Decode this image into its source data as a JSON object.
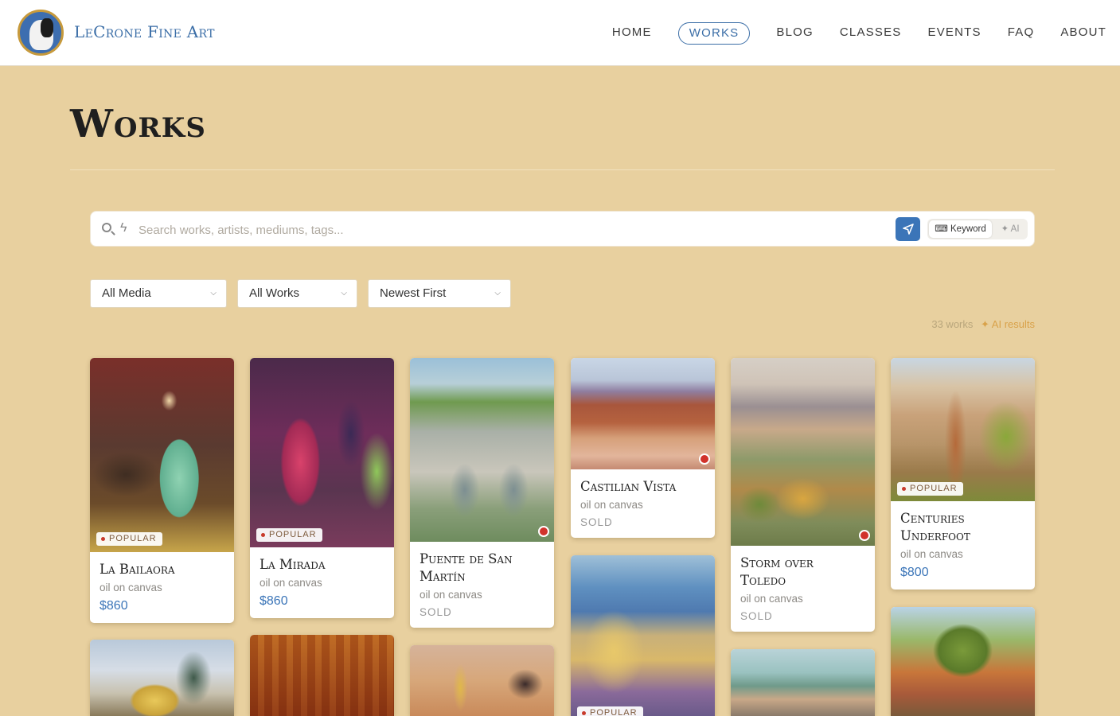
{
  "brand": {
    "name": "LeCrone Fine Art"
  },
  "nav": {
    "home": "HOME",
    "works": "WORKS",
    "blog": "BLOG",
    "classes": "CLASSES",
    "events": "EVENTS",
    "faq": "FAQ",
    "about": "ABOUT"
  },
  "page": {
    "title": "Works"
  },
  "search": {
    "placeholder": "Search works, artists, mediums, tags...",
    "mode_keyword": "⌨ Keyword",
    "mode_ai": "✦ AI"
  },
  "filters": {
    "media": "All Media",
    "works": "All Works",
    "sort": "Newest First"
  },
  "results": {
    "count": "33 works",
    "ai_label": "✦ AI results"
  },
  "badges": {
    "popular": "POPULAR",
    "sold": "SOLD"
  },
  "works": [
    {
      "title": "La Bailaora",
      "medium": "oil on canvas",
      "price": "$860",
      "popular": true
    },
    {
      "title": "La Mirada",
      "medium": "oil on canvas",
      "price": "$860",
      "popular": true
    },
    {
      "title": "Puente de San Martín",
      "medium": "oil on canvas",
      "status": "SOLD"
    },
    {
      "title": "Castilian Vista",
      "medium": "oil on canvas",
      "status": "SOLD"
    },
    {
      "title": "Storm over Toledo",
      "medium": "oil on canvas",
      "status": "SOLD"
    },
    {
      "title": "Centuries Underfoot",
      "medium": "oil on canvas",
      "price": "$800",
      "popular": true
    }
  ],
  "colors": {
    "background": "#e8d09f",
    "accent": "#3b75b8",
    "sold_dot": "#d1322b"
  }
}
